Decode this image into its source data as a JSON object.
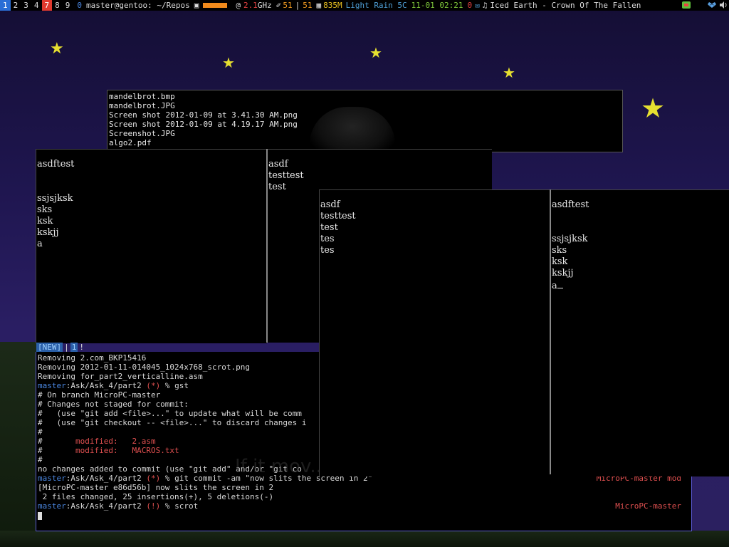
{
  "topbar": {
    "workspaces": [
      {
        "label": "1",
        "state": "active"
      },
      {
        "label": "2",
        "state": "normal"
      },
      {
        "label": "3",
        "state": "normal"
      },
      {
        "label": "4",
        "state": "normal"
      },
      {
        "label": "7",
        "state": "urgent"
      },
      {
        "label": "8",
        "state": "normal"
      },
      {
        "label": "9",
        "state": "normal"
      }
    ],
    "window_count": "0",
    "window_title": "master@gentoo: ~/Repos",
    "cpu_freq_prefix": "@",
    "cpu_freq_value": "2.1",
    "cpu_freq_unit": "GHz",
    "temp1": "51",
    "temp_sep": "|",
    "temp2": "51",
    "memory": "835M",
    "weather": "Light Rain 5C",
    "date": "11-01 02:21",
    "mail_count": "0",
    "now_playing": "Iced Earth - Crown Of The Fallen",
    "cpu_bar_level": 0.65
  },
  "file_list": [
    "mandelbrot.bmp",
    "mandelbrot.JPG",
    "Screen shot 2012-01-09 at 3.41.30 AM.png",
    "Screen shot 2012-01-09 at 4.19.17 AM.png",
    "Screenshot.JPG",
    "algo2.pdf"
  ],
  "pane1_lines": [
    "asdftest",
    "",
    "",
    "ssjsjksk",
    "sks",
    "ksk",
    "kskjj",
    "a"
  ],
  "pane2_lines": [
    "asdf",
    "testtest",
    "test",
    "tes",
    "tes"
  ],
  "pane3_lines": [
    "asdf",
    "testtest",
    "test",
    "tes",
    "tes"
  ],
  "pane4_lines": [
    "asdftest",
    "",
    "",
    "ssjsjksk",
    "sks",
    "ksk",
    "kskjj",
    "a"
  ],
  "status": {
    "tag1": "[NEW]",
    "sep": "|",
    "tag2": "1",
    "tail": "!"
  },
  "shell": {
    "lines": [
      {
        "type": "plain",
        "text": "Removing 2.com_BKP15416"
      },
      {
        "type": "plain",
        "text": "Removing 2012-01-11-014045_1024x768_scrot.png"
      },
      {
        "type": "plain",
        "text": "Removing for_part2_verticalline.asm"
      },
      {
        "type": "prompt",
        "user": "master",
        "path": ":Ask/Ask_4/part2",
        "flag": "(*)",
        "cmd": "% gst",
        "right": ""
      },
      {
        "type": "plain",
        "text": "# On branch MicroPC-master"
      },
      {
        "type": "plain",
        "text": "# Changes not staged for commit:"
      },
      {
        "type": "plain",
        "text": "#   (use \"git add <file>...\" to update what will be comm"
      },
      {
        "type": "plain",
        "text": "#   (use \"git checkout -- <file>...\" to discard changes i"
      },
      {
        "type": "plain",
        "text": "#"
      },
      {
        "type": "mod",
        "text": "#       modified:   2.asm"
      },
      {
        "type": "mod",
        "text": "#       modified:   MACROS.txt"
      },
      {
        "type": "plain",
        "text": "#"
      },
      {
        "type": "plain",
        "text": "no changes added to commit (use \"git add\" and/or \"git co"
      },
      {
        "type": "prompt",
        "user": "master",
        "path": ":Ask/Ask_4/part2",
        "flag": "(*)",
        "cmd": "% git commit -am \"now slits the screen in 2\"",
        "right": "MicroPC-master mod"
      },
      {
        "type": "plain",
        "text": "[MicroPC-master e86d56b] now slits the screen in 2"
      },
      {
        "type": "plain",
        "text": " 2 files changed, 25 insertions(+), 5 deletions(-)"
      },
      {
        "type": "prompt",
        "user": "master",
        "path": ":Ask/Ask_4/part2",
        "flag": "(!)",
        "cmd": "% scrot",
        "right": "MicroPC-master"
      }
    ]
  },
  "wallpaper_text": "If it mov... ...pho ..."
}
